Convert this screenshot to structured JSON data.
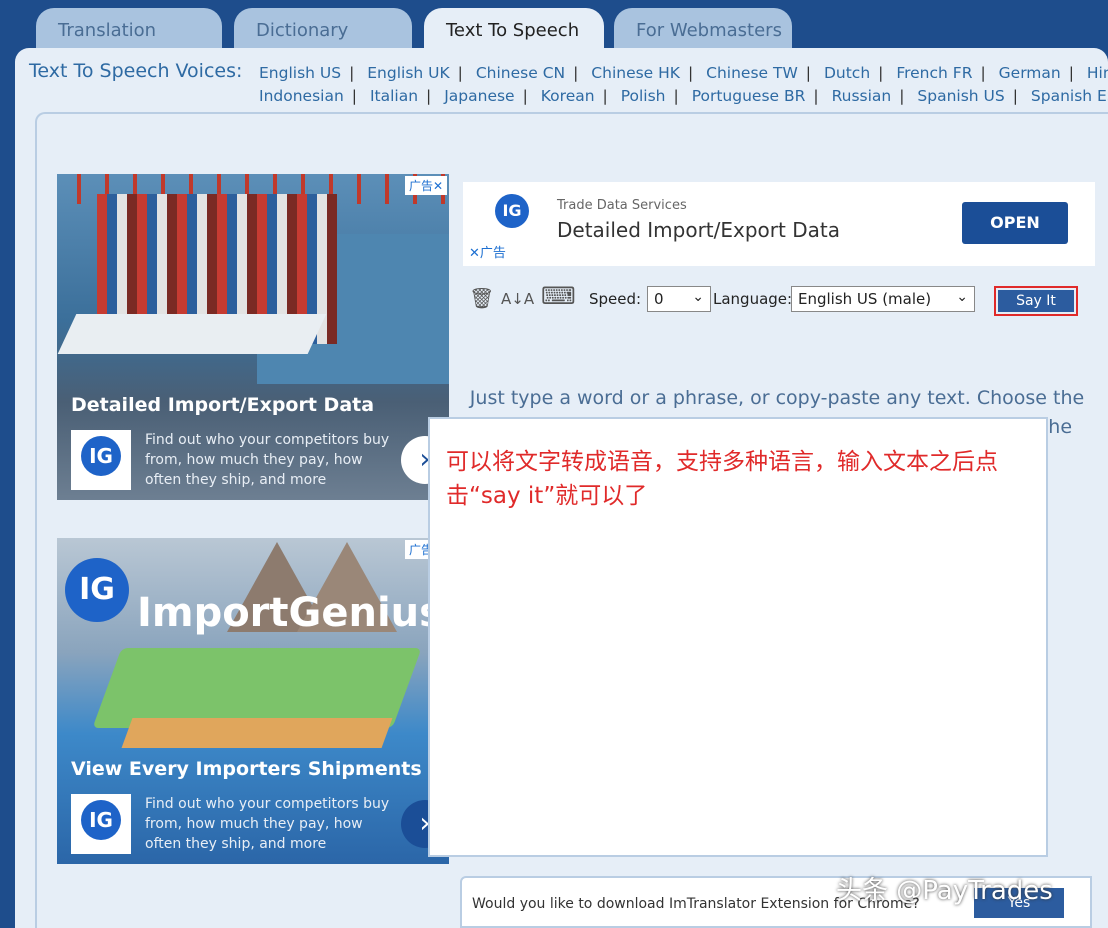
{
  "tabs": [
    {
      "label": "Translation"
    },
    {
      "label": "Dictionary"
    },
    {
      "label": "Text To Speech"
    },
    {
      "label": "For Webmasters"
    }
  ],
  "voices": {
    "label": "Text To Speech Voices:",
    "row1": [
      "English US",
      "English UK",
      "Chinese CN",
      "Chinese HK",
      "Chinese TW",
      "Dutch",
      "French FR",
      "German",
      "Hindi"
    ],
    "row2": [
      "Indonesian",
      "Italian",
      "Japanese",
      "Korean",
      "Polish",
      "Portuguese BR",
      "Russian",
      "Spanish US",
      "Spanish ES"
    ]
  },
  "ad1": {
    "badge": "广告✕",
    "title": "Detailed Import/Export Data",
    "desc": "Find out who your competitors buy from, how much they pay, how often they ship, and more",
    "logo": "IG",
    "arrow": "›"
  },
  "ad2": {
    "badge": "广告✕",
    "brand": "ImportGenius",
    "logo": "IG",
    "title": "View Every Importers Shipments",
    "desc": "Find out who your competitors buy from, how much they pay, how often they ship, and more",
    "arrow": "›"
  },
  "topad": {
    "logo": "IG",
    "sub": "Trade Data Services",
    "head": "Detailed Import/Export Data",
    "open": "OPEN",
    "close": "✕广告"
  },
  "toolbar": {
    "trash_icon": "🗑",
    "sort_icon": "A↓A",
    "keyboard_icon": "⌨",
    "speed_label": "Speed:",
    "speed_value": "0",
    "language_label": "Language:",
    "language_value": "English US (male)",
    "say_it": "Say It"
  },
  "hint": "Just type a word or a phrase, or copy-paste any text. Choose the speech rate that works for you. Start from any position on the text. Replay the text as many times as you wish.",
  "textarea_value": "可以将文字转成语音，支持多种语言，输入文本之后点击“say it”就可以了",
  "bottom": {
    "msg": "Would you like to download ImTranslator Extension for Chrome?",
    "yes": "Yes"
  },
  "watermark": "头条 @PayTrades"
}
